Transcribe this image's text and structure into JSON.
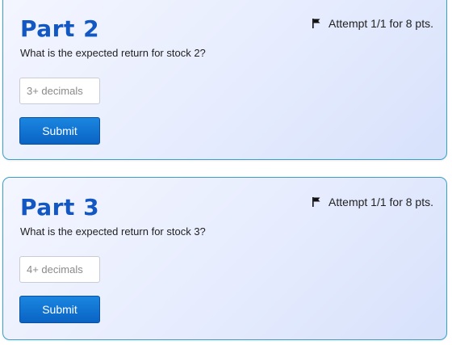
{
  "parts": [
    {
      "title": "Part 2",
      "attempt": "Attempt 1/1 for 8 pts.",
      "question": "What is the expected return for stock 2?",
      "placeholder": "3+ decimals",
      "value": "",
      "submit_label": "Submit"
    },
    {
      "title": "Part 3",
      "attempt": "Attempt 1/1 for 8 pts.",
      "question": "What is the expected return for stock 3?",
      "placeholder": "4+ decimals",
      "value": "",
      "submit_label": "Submit"
    }
  ],
  "icons": {
    "attempt": "flag-icon"
  },
  "colors": {
    "title": "#1257c2",
    "card_border": "#3aa0c8",
    "button": "#0a63c4"
  }
}
